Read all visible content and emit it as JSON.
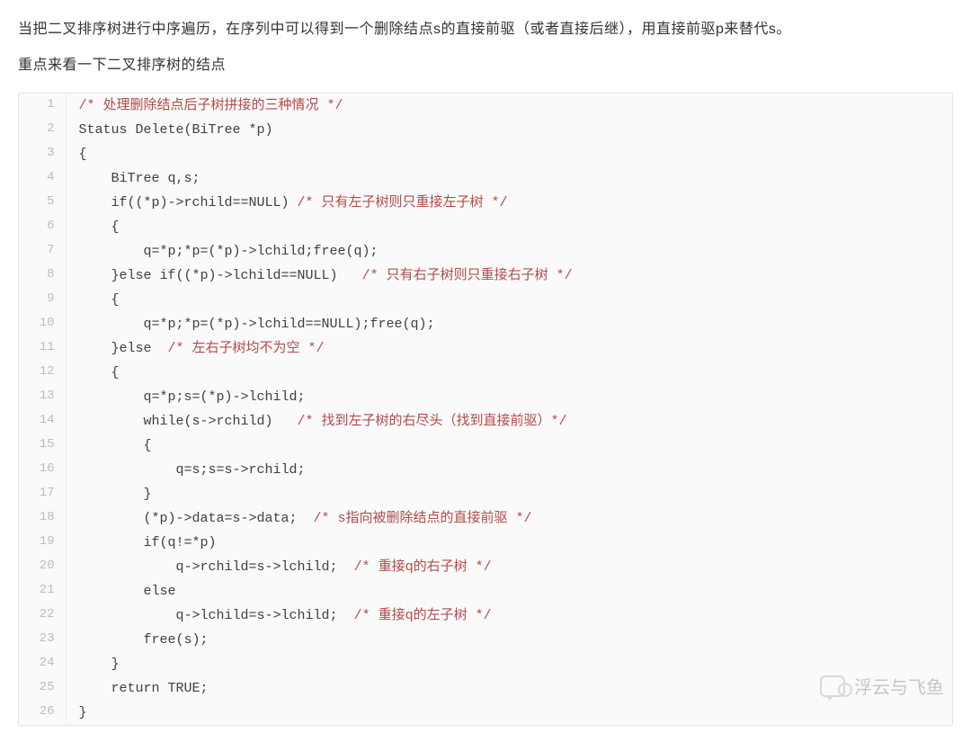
{
  "intro": {
    "p1": "当把二叉排序树进行中序遍历，在序列中可以得到一个删除结点s的直接前驱（或者直接后继），用直接前驱p来替代s。",
    "p2": "重点来看一下二叉排序树的结点"
  },
  "code": {
    "lines": [
      [
        {
          "t": "comment",
          "v": "/* 处理删除结点后子树拼接的三种情况 */"
        }
      ],
      [
        {
          "t": "plain",
          "v": "Status Delete(BiTree *p)"
        }
      ],
      [
        {
          "t": "plain",
          "v": "{"
        }
      ],
      [
        {
          "t": "plain",
          "v": "    BiTree q,s;"
        }
      ],
      [
        {
          "t": "plain",
          "v": "    if((*p)->rchild==NULL) "
        },
        {
          "t": "comment",
          "v": "/* 只有左子树则只重接左子树 */"
        }
      ],
      [
        {
          "t": "plain",
          "v": "    {"
        }
      ],
      [
        {
          "t": "plain",
          "v": "        q=*p;*p=(*p)->lchild;free(q);"
        }
      ],
      [
        {
          "t": "plain",
          "v": "    }else if((*p)->lchild==NULL)   "
        },
        {
          "t": "comment",
          "v": "/* 只有右子树则只重接右子树 */"
        }
      ],
      [
        {
          "t": "plain",
          "v": "    {"
        }
      ],
      [
        {
          "t": "plain",
          "v": "        q=*p;*p=(*p)->lchild==NULL);free(q);"
        }
      ],
      [
        {
          "t": "plain",
          "v": "    }else  "
        },
        {
          "t": "comment",
          "v": "/* 左右子树均不为空 */"
        }
      ],
      [
        {
          "t": "plain",
          "v": "    {"
        }
      ],
      [
        {
          "t": "plain",
          "v": "        q=*p;s=(*p)->lchild;"
        }
      ],
      [
        {
          "t": "plain",
          "v": "        while(s->rchild)   "
        },
        {
          "t": "comment",
          "v": "/* 找到左子树的右尽头（找到直接前驱）*/"
        }
      ],
      [
        {
          "t": "plain",
          "v": "        {"
        }
      ],
      [
        {
          "t": "plain",
          "v": "            q=s;s=s->rchild;"
        }
      ],
      [
        {
          "t": "plain",
          "v": "        }"
        }
      ],
      [
        {
          "t": "plain",
          "v": "        (*p)->data=s->data;  "
        },
        {
          "t": "comment",
          "v": "/* s指向被删除结点的直接前驱 */"
        }
      ],
      [
        {
          "t": "plain",
          "v": "        if(q!=*p)"
        }
      ],
      [
        {
          "t": "plain",
          "v": "            q->rchild=s->lchild;  "
        },
        {
          "t": "comment",
          "v": "/* 重接q的右子树 */"
        }
      ],
      [
        {
          "t": "plain",
          "v": "        else"
        }
      ],
      [
        {
          "t": "plain",
          "v": "            q->lchild=s->lchild;  "
        },
        {
          "t": "comment",
          "v": "/* 重接q的左子树 */"
        }
      ],
      [
        {
          "t": "plain",
          "v": "        free(s);"
        }
      ],
      [
        {
          "t": "plain",
          "v": "    }"
        }
      ],
      [
        {
          "t": "plain",
          "v": "    return TRUE;"
        }
      ],
      [
        {
          "t": "plain",
          "v": "}"
        }
      ]
    ]
  },
  "watermark": {
    "text": "浮云与飞鱼"
  }
}
